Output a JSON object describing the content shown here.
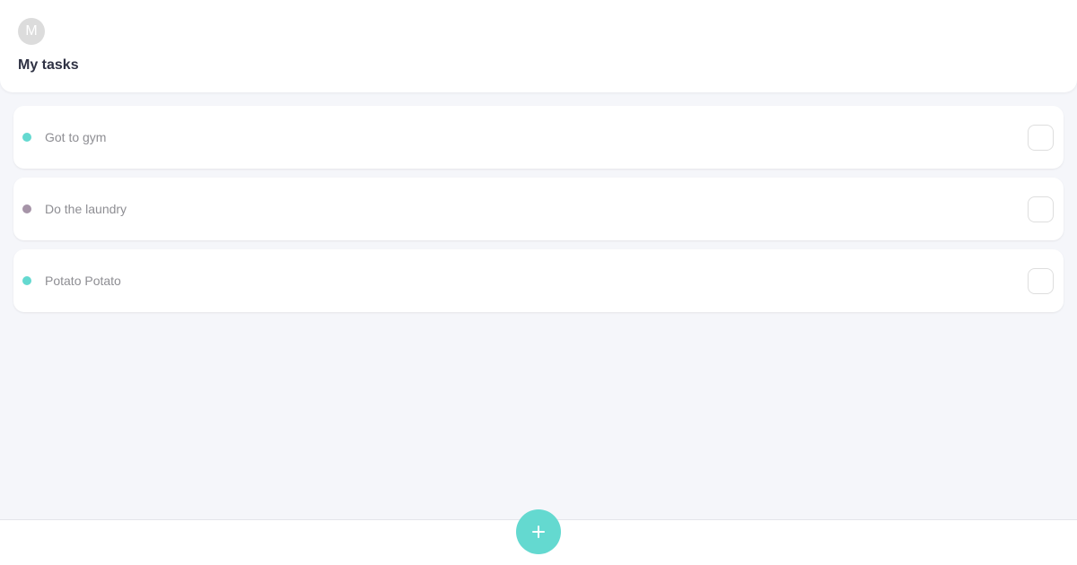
{
  "header": {
    "avatar_initial": "M",
    "title": "My tasks"
  },
  "tasks": [
    {
      "label": "Got to gym",
      "color": "#64d9d0",
      "checked": false
    },
    {
      "label": "Do the laundry",
      "color": "#a694a8",
      "checked": false
    },
    {
      "label": "Potato Potato",
      "color": "#64d9d0",
      "checked": false
    }
  ],
  "footer": {
    "add_icon": "plus-icon",
    "accent_color": "#64d9d0"
  }
}
